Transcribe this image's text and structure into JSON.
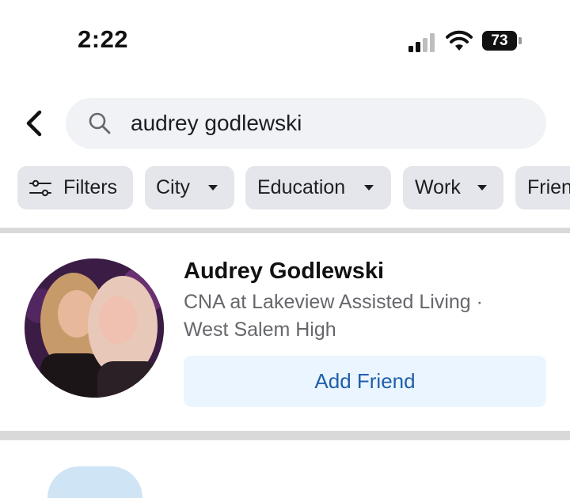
{
  "status_bar": {
    "time": "2:22",
    "battery": "73"
  },
  "search": {
    "query": "audrey godlewski"
  },
  "filters": [
    {
      "label": "Filters",
      "icon": "sliders-icon"
    },
    {
      "label": "City",
      "dropdown": true
    },
    {
      "label": "Education",
      "dropdown": true
    },
    {
      "label": "Work",
      "dropdown": true
    },
    {
      "label": "Frien",
      "dropdown": false
    }
  ],
  "result": {
    "name": "Audrey Godlewski",
    "line1": "CNA at Lakeview Assisted Living ·",
    "line2": "West Salem High",
    "action": "Add Friend"
  },
  "colors": {
    "chip_bg": "#e4e6eb",
    "search_bg": "#f0f2f5",
    "button_bg": "#ebf5ff",
    "button_text": "#1f5faa",
    "secondary_text": "#65676b"
  }
}
